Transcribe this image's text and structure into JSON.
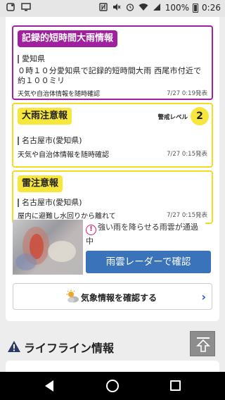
{
  "status_bar": {
    "battery": "100%",
    "time": "0:26",
    "icons": [
      "notification-icon",
      "screen-icon",
      "nfc-icon",
      "mute-icon",
      "alarm-icon",
      "wifi-icon",
      "signal-icon",
      "battery-icon"
    ]
  },
  "alerts": [
    {
      "tag": "記録的短時間大雨情報",
      "region": "愛知県",
      "body": "０時１０分愛知県で記録的短時間大雨 西尾市付近で約１００ミリ",
      "footer": "天気や自治体情報を随時確認",
      "date": "7/27 0:19発表",
      "color": "#a020a0"
    },
    {
      "tag": "大雨注意報",
      "level_label": "警戒レベル",
      "level": "2",
      "region": "名古屋市(愛知県)",
      "footer": "天気や自治体情報を随時確認",
      "date": "7/27 0:15発表",
      "color": "#f1dd22"
    },
    {
      "tag": "雷注意報",
      "region": "名古屋市(愛知県)",
      "footer": "屋内に避難し水回りから離れて",
      "date": "7/27 0:15発表",
      "color": "#f1dd22"
    }
  ],
  "radar": {
    "info_text": "強い雨を降らせる雨雲が通過中",
    "button_label": "雨雲レーダーで確認"
  },
  "weather_button": {
    "label": "気象情報を確認する"
  },
  "lifeline": {
    "title": "ライフライン情報"
  },
  "colors": {
    "accent_blue": "#3b73bb",
    "purple": "#a020a0",
    "yellow": "#f7e63c"
  }
}
